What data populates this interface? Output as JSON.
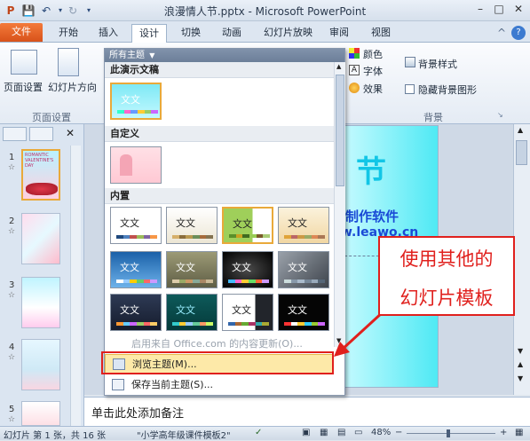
{
  "window": {
    "title": "浪漫情人节.pptx - Microsoft PowerPoint"
  },
  "tabs": [
    {
      "label": "文件"
    },
    {
      "label": "开始"
    },
    {
      "label": "插入"
    },
    {
      "label": "设计"
    },
    {
      "label": "切换"
    },
    {
      "label": "动画"
    },
    {
      "label": "幻灯片放映"
    },
    {
      "label": "审阅"
    },
    {
      "label": "视图"
    }
  ],
  "ribbon": {
    "page_setup": "页面设置",
    "orientation": "幻灯片方向",
    "page_setup_group": "页面设置",
    "colors": "颜色",
    "fonts": "字体",
    "effects": "效果",
    "background_styles": "背景样式",
    "hide_background": "隐藏背景图形",
    "background_group": "背景"
  },
  "dropdown": {
    "header": "所有主题",
    "section_current": "此演示文稿",
    "section_custom": "自定义",
    "section_builtin": "内置",
    "theme_text": "文文",
    "office_content": "启用来自 Office.com 的内容更新(O)...",
    "browse": "浏览主题(M)...",
    "save": "保存当前主题(S)..."
  },
  "slides": [
    {
      "num": "1",
      "thumb_text": "ROMANTIC VALENTINE'S DAY"
    },
    {
      "num": "2"
    },
    {
      "num": "3"
    },
    {
      "num": "4"
    },
    {
      "num": "5"
    }
  ],
  "slide": {
    "title_fragment": "节",
    "line1": "制作软件",
    "line2": "w.leawo.cn"
  },
  "notes": {
    "placeholder": "单击此处添加备注"
  },
  "status": {
    "slide_info": "幻灯片 第 1 张，共 16 张",
    "theme_name": "\"小学高年级课件模板2\"",
    "zoom": "48%"
  },
  "annotation": {
    "line1": "使用其他的",
    "line2": "幻灯片模板"
  },
  "colors": {
    "file_tab": "#e0641f",
    "annotation_red": "#e0201d",
    "slide_cyan": "#4fe9f4"
  }
}
